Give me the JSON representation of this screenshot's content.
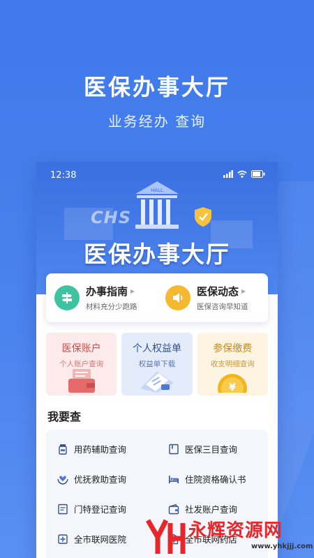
{
  "promo": {
    "title": "医保办事大厅",
    "subtitle": "业务经办 查询"
  },
  "status_bar": {
    "time": "12:38"
  },
  "hero": {
    "badge_text": "CHS",
    "building_label": "HALL",
    "title": "医保办事大厅"
  },
  "quick_links": [
    {
      "title": "办事指南",
      "desc": "材料充分少跑路",
      "icon": "signpost-icon",
      "color": "#3fc2a2"
    },
    {
      "title": "医保动态",
      "desc": "医保咨询早知道",
      "icon": "speaker-icon",
      "color": "#f5b82e"
    }
  ],
  "tiles": [
    {
      "title": "医保账户",
      "subtitle": "个人账户查询",
      "icon": "wallet-icon",
      "bg": "#fdeaea",
      "title_color": "#c94f4f",
      "sub_color": "#d07a7a"
    },
    {
      "title": "个人权益单",
      "subtitle": "权益单下载",
      "icon": "document-download-icon",
      "bg": "#e4ecfb",
      "title_color": "#2e4f9c",
      "sub_color": "#5b75b0"
    },
    {
      "title": "参保缴费",
      "subtitle": "收支明细查询",
      "icon": "coin-icon",
      "bg": "#fdf4e2",
      "title_color": "#c98a1e",
      "sub_color": "#cf9a45"
    }
  ],
  "query_section": {
    "title": "我要查",
    "items": [
      {
        "label": "用药辅助查询",
        "icon": "pill-bottle-icon"
      },
      {
        "label": "医保三目查询",
        "icon": "catalog-book-icon"
      },
      {
        "label": "优抚救助查询",
        "icon": "care-heart-icon"
      },
      {
        "label": "住院资格确认书",
        "icon": "hospital-bed-icon"
      },
      {
        "label": "门特登记查询",
        "icon": "register-form-icon"
      },
      {
        "label": "社发账户查询",
        "icon": "wallet-outline-icon"
      },
      {
        "label": "全市联网医院",
        "icon": "hospital-cross-icon"
      },
      {
        "label": "全市联网药店",
        "icon": "pharmacy-icon"
      }
    ]
  },
  "watermark": {
    "text": "永辉资源网",
    "url": "www.yhkjjj.com"
  },
  "colors": {
    "brand_blue": "#3f79ea",
    "teal": "#3fc2a2",
    "amber": "#f5b82e",
    "watermark_red": "#e8262a"
  }
}
